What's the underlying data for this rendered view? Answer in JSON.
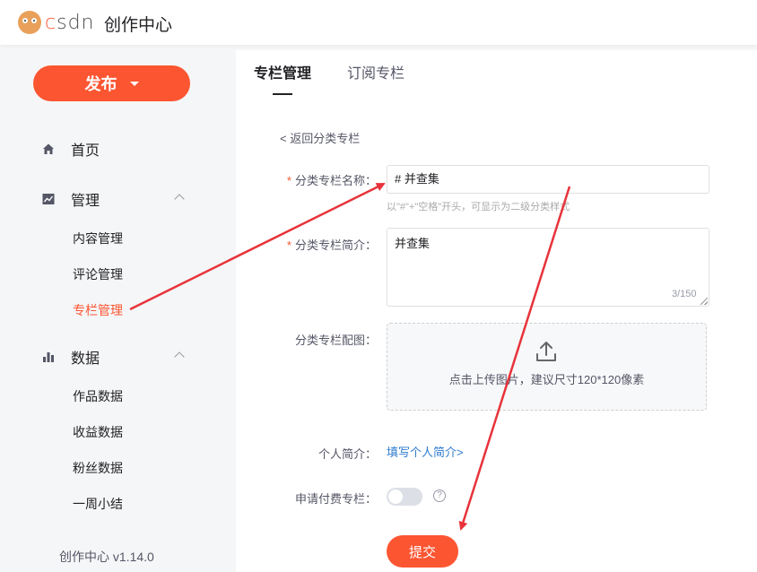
{
  "header": {
    "logo_c": "c",
    "logo_rest": "sdn",
    "title": "创作中心"
  },
  "sidebar": {
    "publish_label": "发布",
    "home": "首页",
    "manage": "管理",
    "manage_items": [
      "内容管理",
      "评论管理",
      "专栏管理"
    ],
    "data": "数据",
    "data_items": [
      "作品数据",
      "收益数据",
      "粉丝数据",
      "一周小结"
    ],
    "version": "创作中心 v1.14.0"
  },
  "main": {
    "tabs": [
      "专栏管理",
      "订阅专栏"
    ],
    "back_link": "< 返回分类专栏",
    "form": {
      "name_label": "分类专栏名称：",
      "name_value": "# 并查集",
      "name_hint": "以\"#\"+\"空格\"开头，可显示为二级分类样式",
      "intro_label": "分类专栏简介：",
      "intro_value": "并查集",
      "intro_counter": "3/150",
      "image_label": "分类专栏配图：",
      "upload_text": "点击上传图片，建议尺寸120*120像素",
      "personal_label": "个人简介：",
      "personal_link": "填写个人简介>",
      "paid_label": "申请付费专栏：",
      "help_glyph": "?",
      "submit_label": "提交"
    }
  },
  "colors": {
    "accent": "#fc5531",
    "link": "#2e7bcf",
    "annotation_arrow": "#e8333a"
  }
}
